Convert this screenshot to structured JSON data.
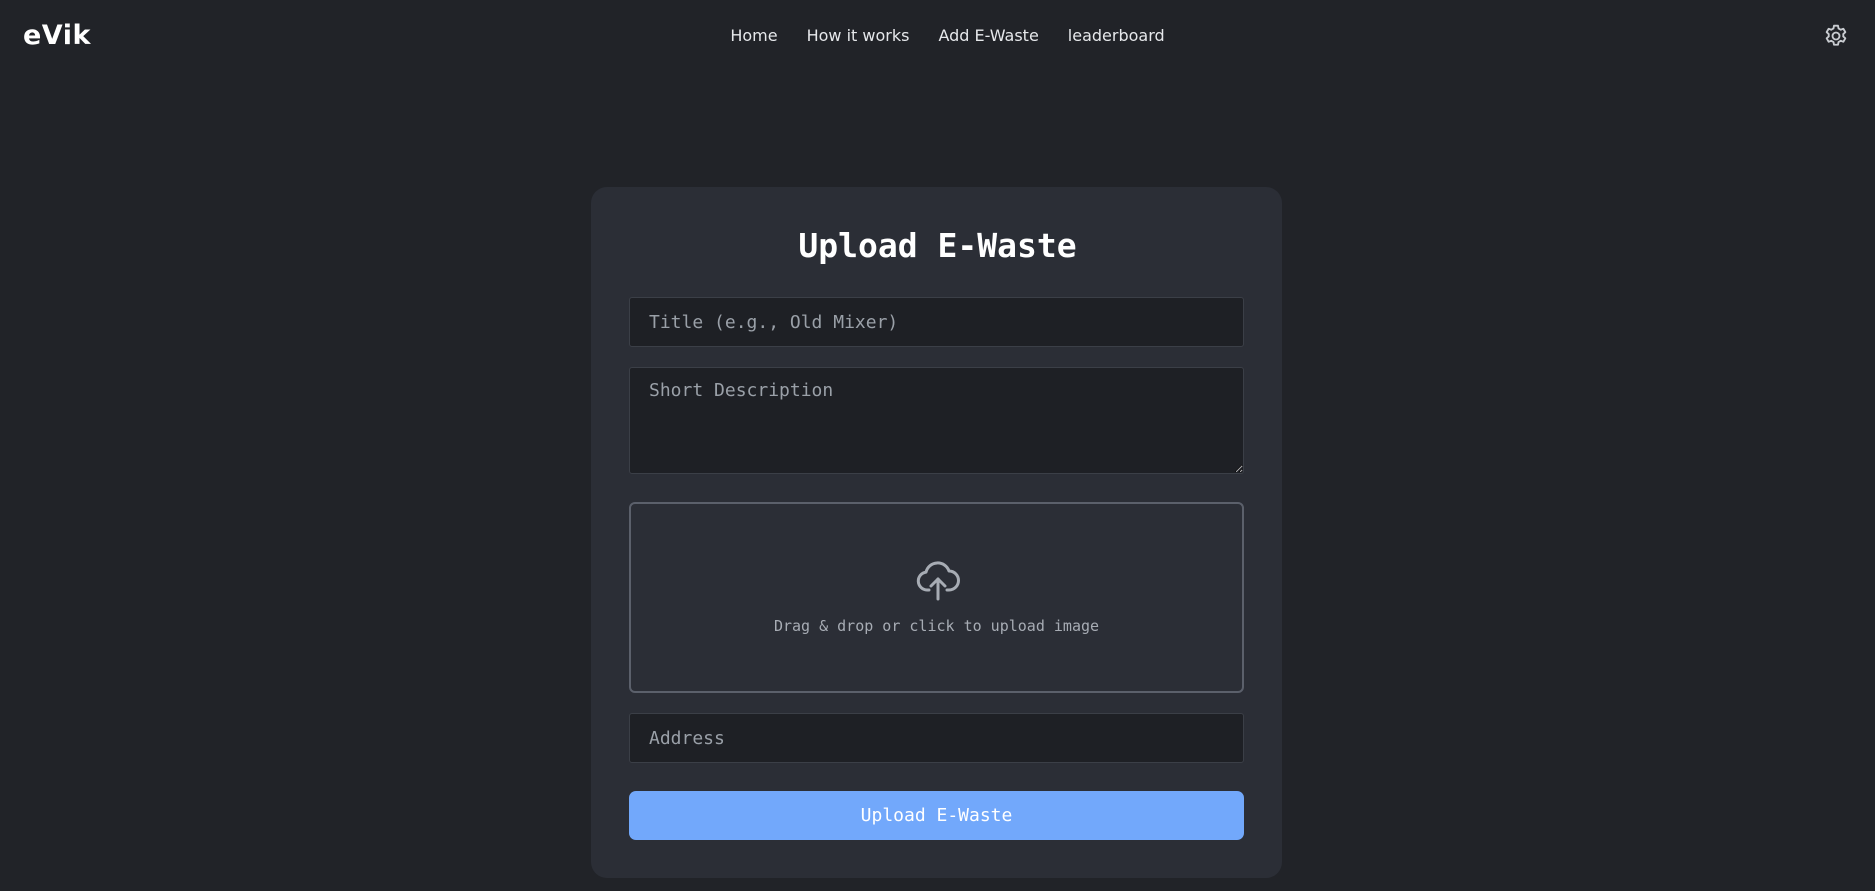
{
  "app": {
    "logo": "eVik"
  },
  "nav": {
    "items": [
      {
        "label": "Home"
      },
      {
        "label": "How it works"
      },
      {
        "label": "Add E-Waste"
      },
      {
        "label": "leaderboard"
      }
    ],
    "settings_icon": "gear-icon"
  },
  "form": {
    "heading": "Upload E-Waste",
    "title_field": {
      "value": "",
      "placeholder": "Title (e.g., Old Mixer)"
    },
    "description_field": {
      "value": "",
      "placeholder": "Short Description"
    },
    "dropzone": {
      "icon": "cloud-upload-icon",
      "text": "Drag & drop or click to upload image"
    },
    "address_field": {
      "value": "",
      "placeholder": "Address"
    },
    "submit_label": "Upload E-Waste"
  },
  "colors": {
    "background": "#212328",
    "card": "#2b2e36",
    "input_bg": "#1e2025",
    "accent": "#72a8fb"
  }
}
